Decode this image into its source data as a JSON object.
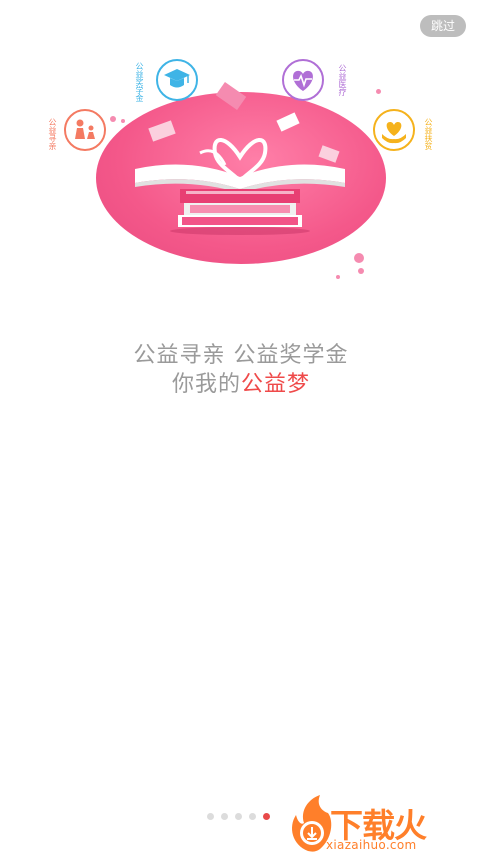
{
  "skip": {
    "label": "跳过"
  },
  "hero": {
    "icons": [
      {
        "name": "family-icon",
        "label": "公益寻亲",
        "color": "#f47a62"
      },
      {
        "name": "graduation-cap-icon",
        "label": "公益奖学金",
        "color": "#3fb4e6"
      },
      {
        "name": "heartbeat-icon",
        "label": "公益医疗",
        "color": "#b06fd6"
      },
      {
        "name": "love-hands-icon",
        "label": "公益扶贫",
        "color": "#f5b21c"
      }
    ]
  },
  "slogan": {
    "line1": "公益寻亲  公益奖学金",
    "line2_prefix": "你我的",
    "line2_highlight": "公益梦"
  },
  "pager": {
    "count": 5,
    "active_index": 4
  },
  "watermark": {
    "text": "下载火",
    "url": "xiazaihuo.com"
  },
  "colors": {
    "accent": "#ef4a4a",
    "circle": "#f4588a",
    "text": "#9a9a9a",
    "watermark": "#ff7f2a"
  }
}
